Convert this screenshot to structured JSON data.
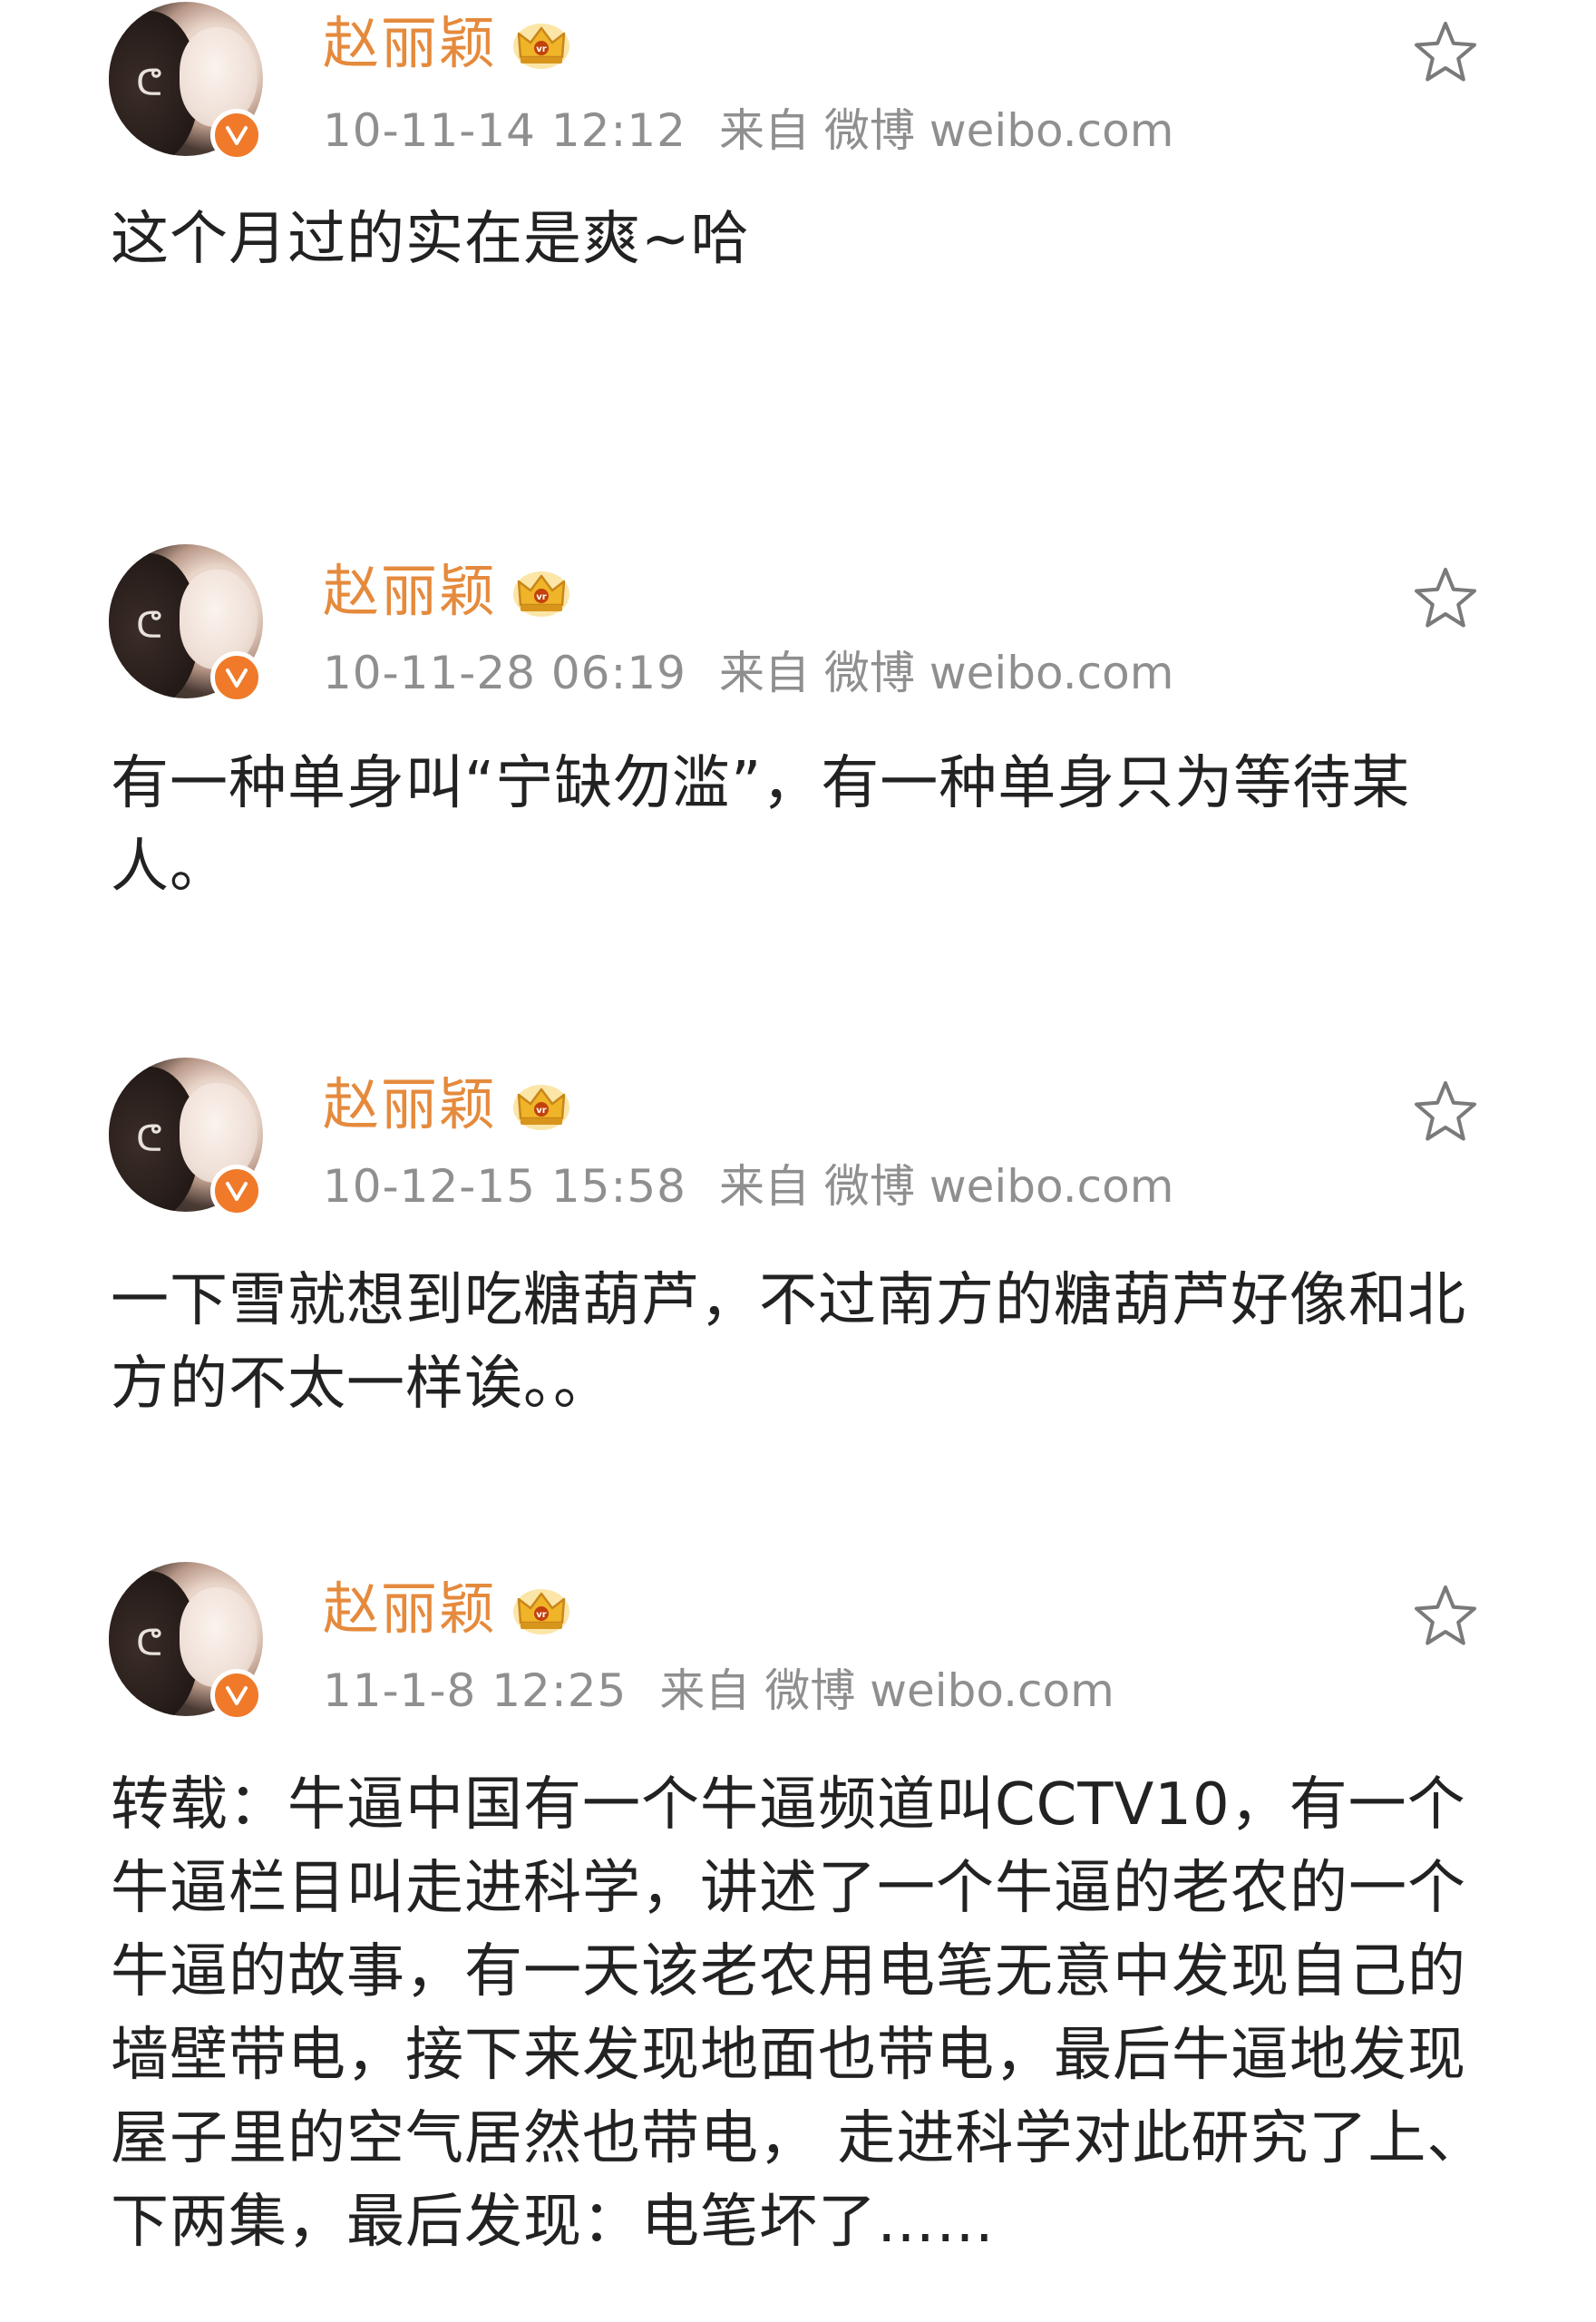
{
  "colors": {
    "username": "#e58a3c",
    "meta": "#8f8f8f",
    "content": "#222222",
    "verified_badge": "#f07a2a",
    "crown": "#f0b429",
    "star": "#7a7a7a"
  },
  "posts": [
    {
      "username": "赵丽颖",
      "time": "10-11-14 12:12",
      "source": "来自 微博 weibo.com",
      "text": "这个月过的实在是爽~哈"
    },
    {
      "username": "赵丽颖",
      "time": "10-11-28 06:19",
      "source": "来自 微博 weibo.com",
      "text": "有一种单身叫“宁缺勿滥”，有一种单身只为等待某人。"
    },
    {
      "username": "赵丽颖",
      "time": "10-12-15 15:58",
      "source": "来自 微博 weibo.com",
      "text": "一下雪就想到吃糖葫芦，不过南方的糖葫芦好像和北方的不太一样诶。。"
    },
    {
      "username": "赵丽颖",
      "time": "11-1-8 12:25",
      "source": "来自 微博 weibo.com",
      "text": "转载：牛逼中国有一个牛逼频道叫CCTV10，有一个牛逼栏目叫走进科学，讲述了一个牛逼的老农的一个牛逼的故事，有一天该老农用电笔无意中发现自己的墙壁带电，接下来发现地面也带电，最后牛逼地发现屋子里的空气居然也带电， 走进科学对此研究了上、下两集，最后发现：电笔坏了……"
    }
  ],
  "icons": {
    "avatar": "avatar-photo",
    "verified": "verified-v-icon",
    "member": "crown-icon",
    "favorite": "star-icon"
  }
}
